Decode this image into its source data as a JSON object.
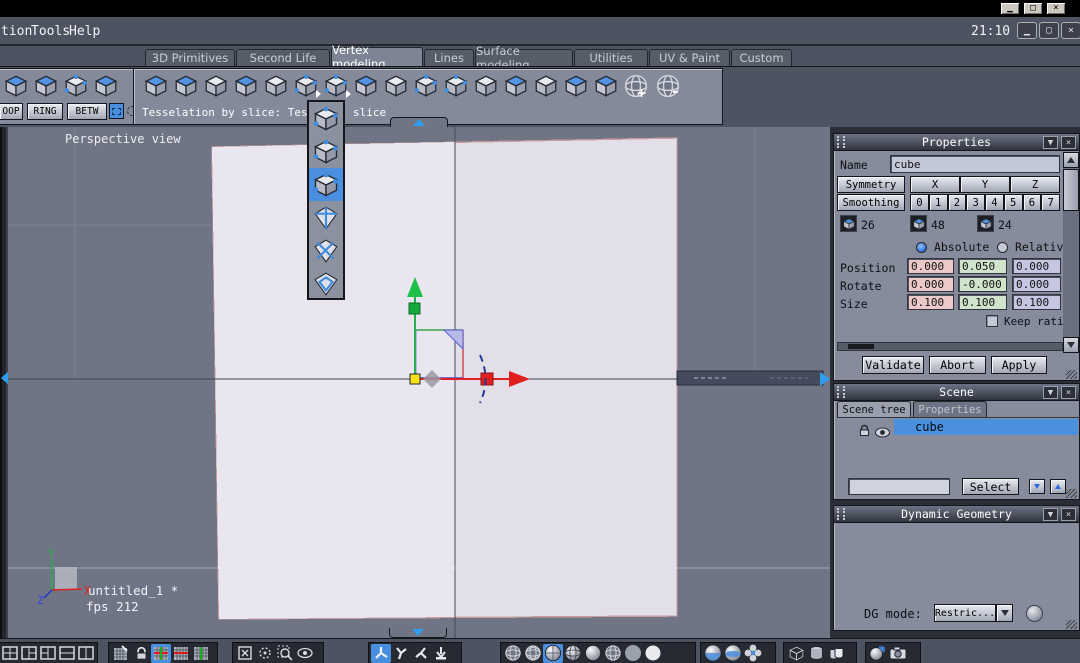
{
  "titlebar": {
    "clock": "21:10"
  },
  "menubar": {
    "items": [
      "tion",
      "Tools",
      "Help"
    ]
  },
  "tabs": {
    "active": "Vertex modeling",
    "items": [
      {
        "label": "3D Primitives"
      },
      {
        "label": "Second Life"
      },
      {
        "label": "Vertex modeling"
      },
      {
        "label": "Lines"
      },
      {
        "label": "Surface modeling"
      },
      {
        "label": "Utilities"
      },
      {
        "label": "UV & Paint"
      },
      {
        "label": "Custom"
      }
    ]
  },
  "left_tools": {
    "buttons": [
      "OOP",
      "RING",
      "BETW"
    ]
  },
  "toolbar": {
    "status_left": "Tesselation by slice: Tessela",
    "status_right": "slice",
    "icon_names": [
      "flip-sheet",
      "cap-cube",
      "round-corner-cube",
      "pierce-cube",
      "slice-layers",
      "tesselate-points",
      "tesselate-by-slice",
      "fold-sheet",
      "smooth-cut",
      "stitch-points",
      "cluster-cubes",
      "wedge-cylinder",
      "wrap-face",
      "pinch-sheet",
      "cap-extrude",
      "mirror-halves",
      "sphere-detail-add",
      "sphere-detail-remove"
    ],
    "flyout_icon_names": [
      "tesselate-marked-1",
      "tesselate-marked-2",
      "tesselate-marked-3",
      "pane-split-cross",
      "pane-diag-cross",
      "pane-inner-diamond"
    ],
    "flyout_selected_index": 2
  },
  "viewport": {
    "label": "Perspective view",
    "file": "untitled_1 *",
    "fps": "fps 212",
    "axis_x": "X",
    "axis_y": "Y",
    "axis_z": "Z"
  },
  "properties": {
    "title": "Properties",
    "name_label": "Name",
    "name_value": "cube",
    "symmetry": "Symmetry",
    "axis_buttons": [
      "X",
      "Y",
      "Z"
    ],
    "smoothing": "Smoothing",
    "levels": [
      "0",
      "1",
      "2",
      "3",
      "4",
      "5",
      "6",
      "7"
    ],
    "vertex_count": "26",
    "edge_count": "48",
    "face_count": "24",
    "absolute": "Absolute",
    "relative": "Relative",
    "rows": [
      {
        "label": "Position",
        "x": "0.000",
        "y": "0.050",
        "z": "0.000"
      },
      {
        "label": "Rotate",
        "x": "0.000",
        "y": "-0.000",
        "z": "0.000"
      },
      {
        "label": "Size",
        "x": "0.100",
        "y": "0.100",
        "z": "0.100"
      }
    ],
    "keep_ratio": "Keep ratio",
    "validate": "Validate",
    "abort": "Abort",
    "apply": "Apply"
  },
  "scene": {
    "title": "Scene",
    "tab_tree": "Scene tree",
    "tab_props": "Properties",
    "item": "cube",
    "select": "Select"
  },
  "dynamic_geometry": {
    "title": "Dynamic Geometry",
    "mode_label": "DG mode:",
    "mode_value": "Restric..."
  },
  "bottom_toolbar": {
    "group_icon_names": [
      [
        "layout-single",
        "layout-quad",
        "layout-left-split",
        "layout-right-split",
        "layout-h-split",
        "layout-v-split"
      ],
      [
        "grid-draw",
        "grid-lock",
        "grid-xy-axes",
        "grid-x-axis",
        "grid-y-axis"
      ],
      [
        "fit-view",
        "center-view",
        "zoom-region",
        "look-at"
      ],
      [
        "move-tool",
        "rotate-tool",
        "scale-tool",
        "drop-tool"
      ],
      [
        "display-wireframe",
        "display-wire-dense",
        "display-shaded-wire",
        "display-shaded-grid",
        "display-smooth",
        "display-wire-hidden",
        "display-flat",
        "display-smooth-white"
      ],
      [
        "render-sphere",
        "material-sphere",
        "banded-sphere",
        "multi-sphere"
      ],
      [
        "wire-cube",
        "cylinder",
        "containers"
      ],
      [
        "light",
        "camera"
      ]
    ],
    "selected": [
      "grid-xy-axes",
      "move-tool",
      "display-shaded-wire"
    ]
  },
  "colors": {
    "accent_blue": "#4a8fdf",
    "selection_blue": "#4a90dd",
    "field_x_pink": "#ecc9c9",
    "field_y_green": "#d0e3cb",
    "field_z_lavender": "#c6c6e2",
    "axis_x_red": "#e02020",
    "axis_y_green": "#22b24c",
    "axis_z_blue": "#2233cc",
    "viewport_bg": "#6f7584",
    "cube_face": "#e2dfe9"
  }
}
